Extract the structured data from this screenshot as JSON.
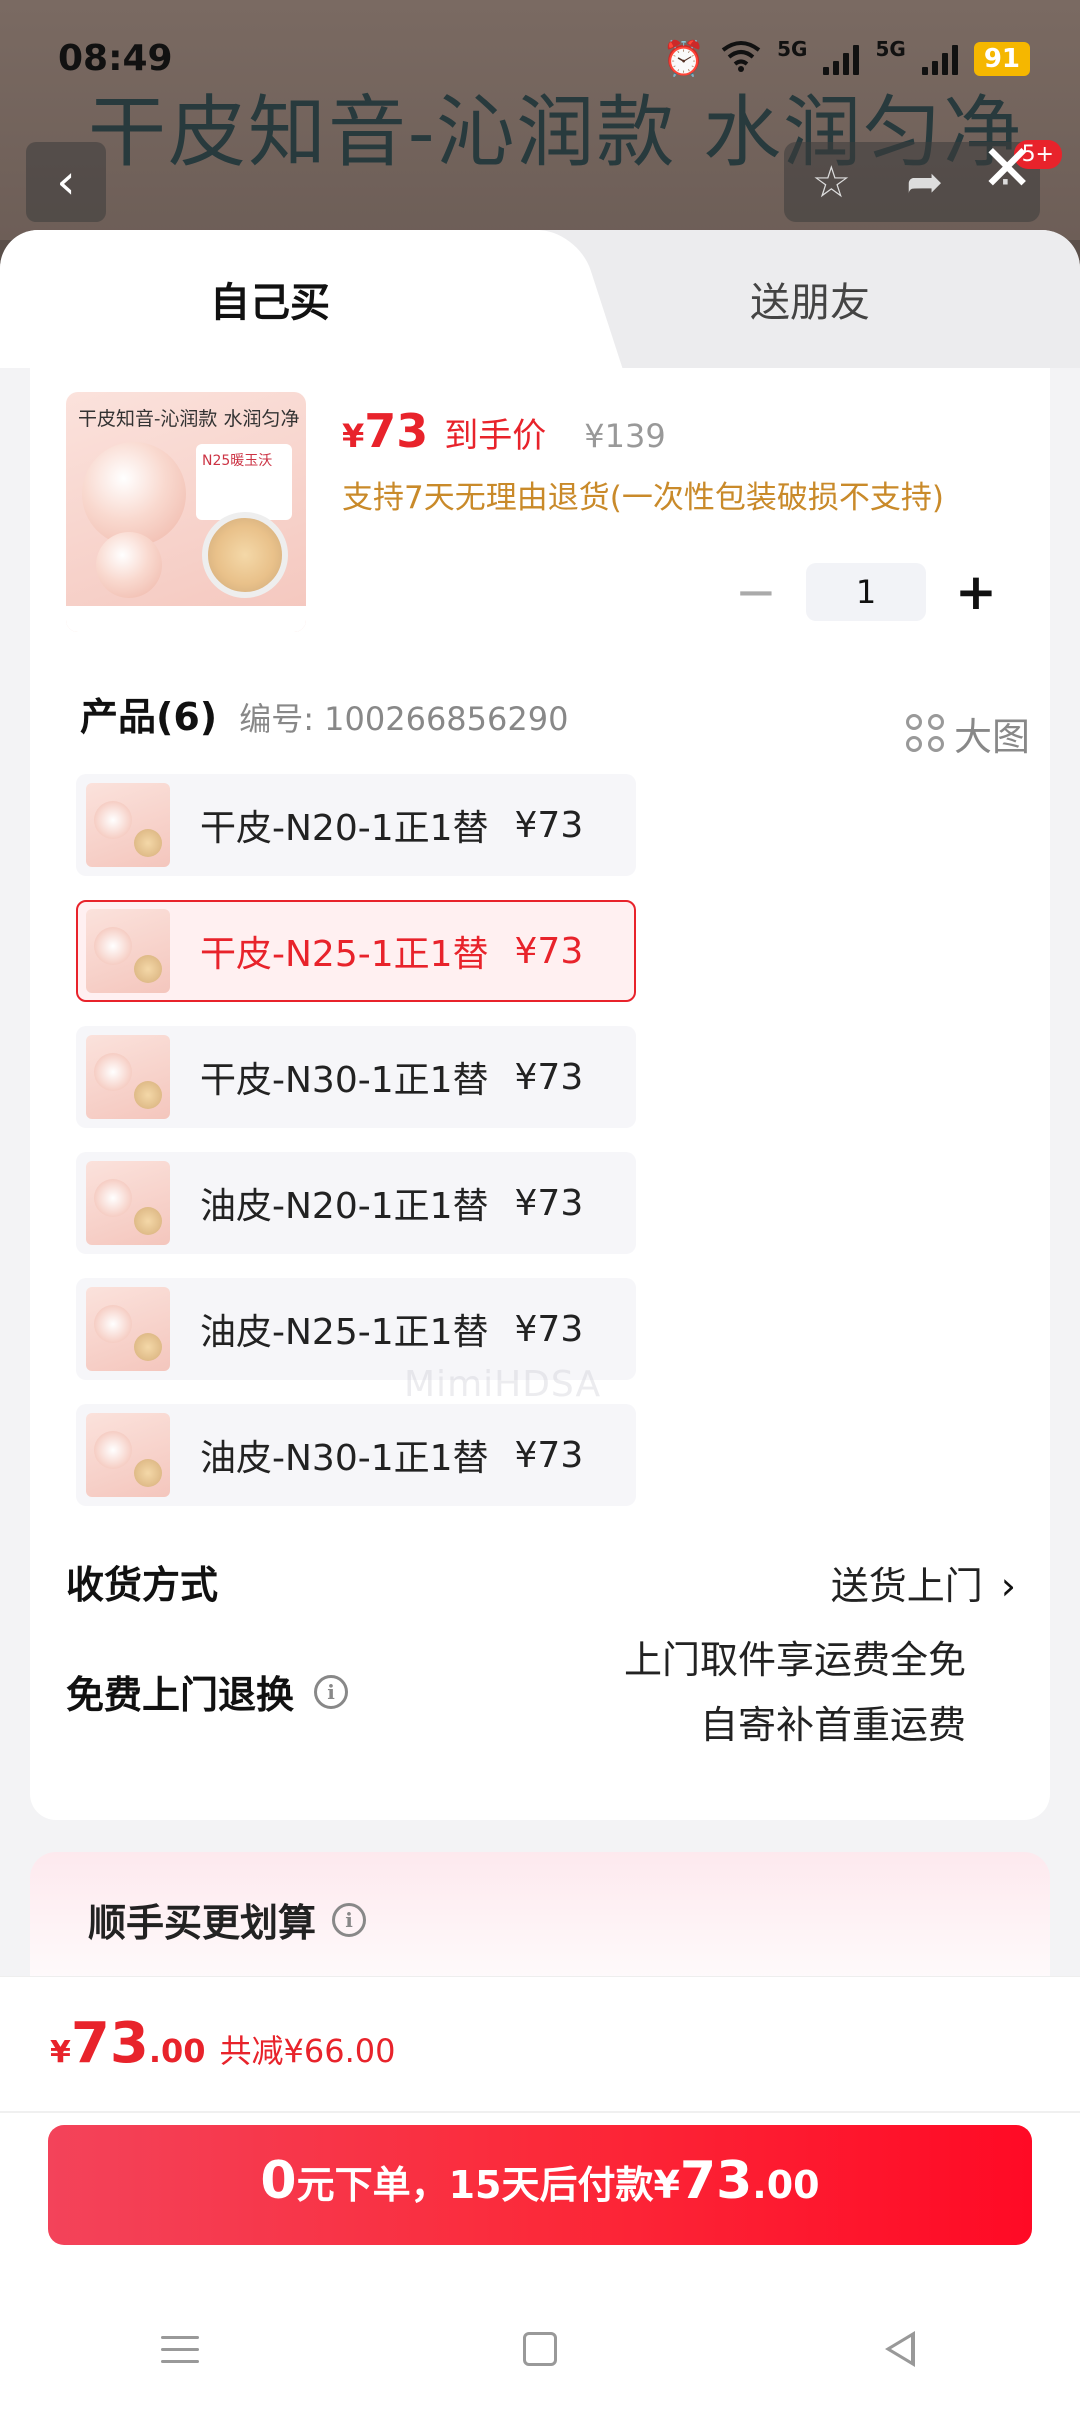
{
  "status_bar": {
    "time": "08:49",
    "net1": "5G",
    "net2": "5G",
    "battery": "91"
  },
  "background": {
    "title": "干皮知音-沁润款 水润匀净",
    "notification_badge": "5+"
  },
  "tabs": [
    {
      "label": "自己买",
      "active": true
    },
    {
      "label": "送朋友",
      "active": false
    }
  ],
  "product": {
    "thumb_title": "干皮知音-沁润款 水润匀净",
    "thumb_tag": "N25暖玉沃",
    "price_symbol": "¥",
    "price": "73",
    "price_label": "到手价",
    "original_price": "¥139",
    "return_policy": "支持7天无理由退货(一次性包装破损不支持)",
    "quantity": "1",
    "minus": "−",
    "plus": "+"
  },
  "variants_section": {
    "title": "产品(6)",
    "code": "编号: 100266856290",
    "big_image_label": "大图",
    "items": [
      {
        "name": "干皮-N20-1正1替",
        "price": "¥73",
        "selected": false
      },
      {
        "name": "干皮-N25-1正1替",
        "price": "¥73",
        "selected": true
      },
      {
        "name": "干皮-N30-1正1替",
        "price": "¥73",
        "selected": false
      },
      {
        "name": "油皮-N20-1正1替",
        "price": "¥73",
        "selected": false
      },
      {
        "name": "油皮-N25-1正1替",
        "price": "¥73",
        "selected": false
      },
      {
        "name": "油皮-N30-1正1替",
        "price": "¥73",
        "selected": false
      }
    ]
  },
  "delivery": {
    "label": "收货方式",
    "value": "送货上门"
  },
  "free_return": {
    "label": "免费上门退换",
    "value_line1": "上门取件享运费全免",
    "value_line2": "自寄补首重运费"
  },
  "promo": {
    "title": "顺手买更划算"
  },
  "watermark": "MimiHDSA",
  "bottom": {
    "total_symbol": "¥",
    "total_int": "73",
    "total_dec": ".00",
    "saving": "共减¥66.00",
    "cta_prefix_big": "0",
    "cta_text": "元下单，15天后付款¥",
    "cta_amount": "73",
    "cta_dec": ".00"
  },
  "colors": {
    "accent": "#e8232b",
    "policy": "#c98a2a",
    "cta_start": "#f3435a",
    "cta_end": "#ff0a25"
  }
}
